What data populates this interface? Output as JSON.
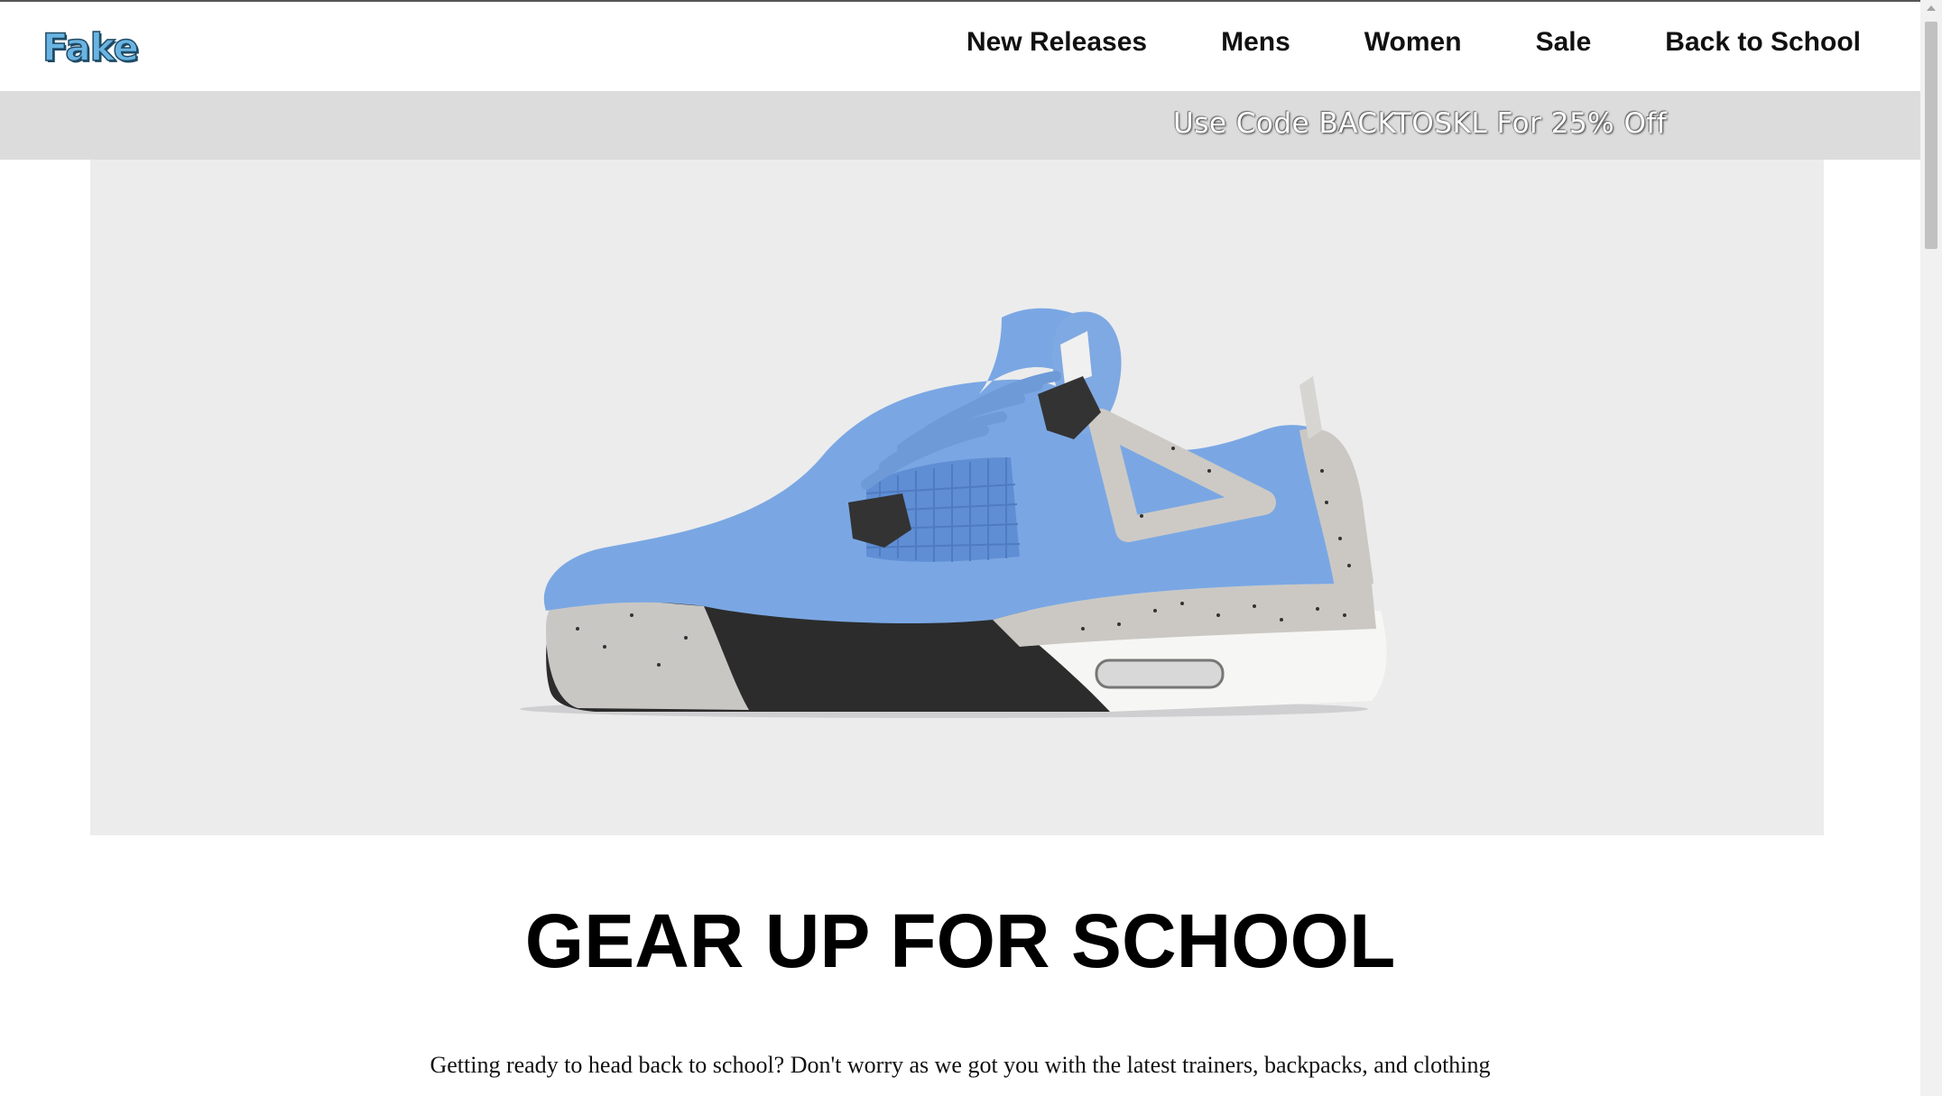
{
  "brand": {
    "logo_text": "Fake"
  },
  "nav": {
    "items": [
      {
        "label": "New Releases"
      },
      {
        "label": "Mens"
      },
      {
        "label": "Women"
      },
      {
        "label": "Sale"
      },
      {
        "label": "Back to School"
      }
    ]
  },
  "promo": {
    "text": "Use Code BACKTOSKL For 25% Off"
  },
  "hero": {
    "image": "blue-sneaker-image",
    "colors": {
      "background": "#ececed",
      "upper": "#7aa7e3",
      "accent_dark": "#2e2e2e",
      "speckle_grey": "#c9c7c4"
    }
  },
  "main": {
    "headline": "GEAR UP FOR SCHOOL",
    "intro": "Getting ready to head back to school? Don't worry as we got you with the latest trainers, backpacks, and clothing"
  },
  "colors": {
    "logo": "#6ab4e2",
    "promo_bar": "#dcdcdc",
    "nav_text": "#111111"
  }
}
